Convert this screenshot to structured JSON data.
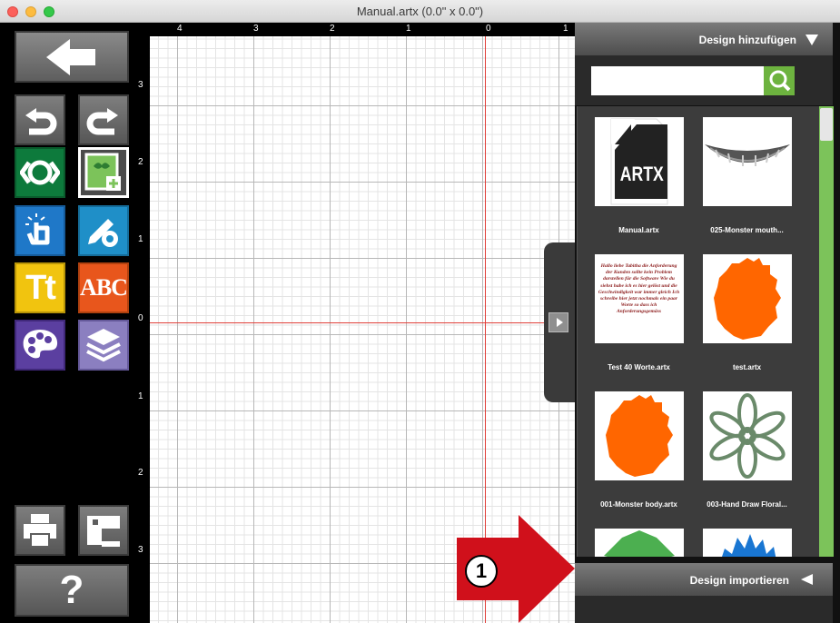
{
  "window": {
    "title": "Manual.artx (0.0\" x 0.0\")"
  },
  "toolbar": {
    "buttons": [
      {
        "name": "back",
        "icon": "arrow-left-icon"
      },
      {
        "name": "undo",
        "icon": "undo-icon"
      },
      {
        "name": "redo",
        "icon": "redo-icon"
      },
      {
        "name": "preview",
        "icon": "eye-icon"
      },
      {
        "name": "add-design",
        "icon": "image-add-icon"
      },
      {
        "name": "select",
        "icon": "hand-pointer-icon"
      },
      {
        "name": "edit-design",
        "icon": "pencil-gear-icon"
      },
      {
        "name": "text",
        "icon": "text-icon"
      },
      {
        "name": "monogram",
        "icon": "monogram-icon"
      },
      {
        "name": "colors",
        "icon": "palette-icon"
      },
      {
        "name": "layers",
        "icon": "layers-icon"
      },
      {
        "name": "print",
        "icon": "printer-icon"
      },
      {
        "name": "send-to-machine",
        "icon": "machine-icon"
      },
      {
        "name": "help",
        "icon": "help-icon"
      }
    ],
    "text_icon_label": "Tt",
    "monogram_label": "ABC",
    "help_label": "?"
  },
  "ruler": {
    "top": [
      "4",
      "3",
      "2",
      "1",
      "0",
      "1"
    ],
    "left": [
      "3",
      "2",
      "1",
      "0",
      "1",
      "2",
      "3"
    ]
  },
  "panel": {
    "header": "Design hinzufügen",
    "search_placeholder": "",
    "footer": "Design importieren",
    "items": [
      {
        "caption": "Manual.artx",
        "thumb_text": "ARTX"
      },
      {
        "caption": "025-Monster mouth..."
      },
      {
        "caption": "Test 40 Worte.artx"
      },
      {
        "caption": "test.artx"
      },
      {
        "caption": "001-Monster body.artx"
      },
      {
        "caption": "003-Hand Draw Floral..."
      }
    ],
    "embroidery_preview": "Hallo liebe Tabitha die Anforderung der Kunden sollte kein Problem darstellen für die Software Wie du siehst habe ich es hier gelöst und die Geschwindigkeit war immer gleich Ich schreibe hier jetzt nochmals ein paar Worte so dass ich Anforderungsgemäss"
  },
  "callout": {
    "number": "1",
    "color": "#d0101b"
  },
  "colors": {
    "accent_green": "#6db33f",
    "guide_red": "#e0403a",
    "monster_orange": "#ff6600"
  }
}
